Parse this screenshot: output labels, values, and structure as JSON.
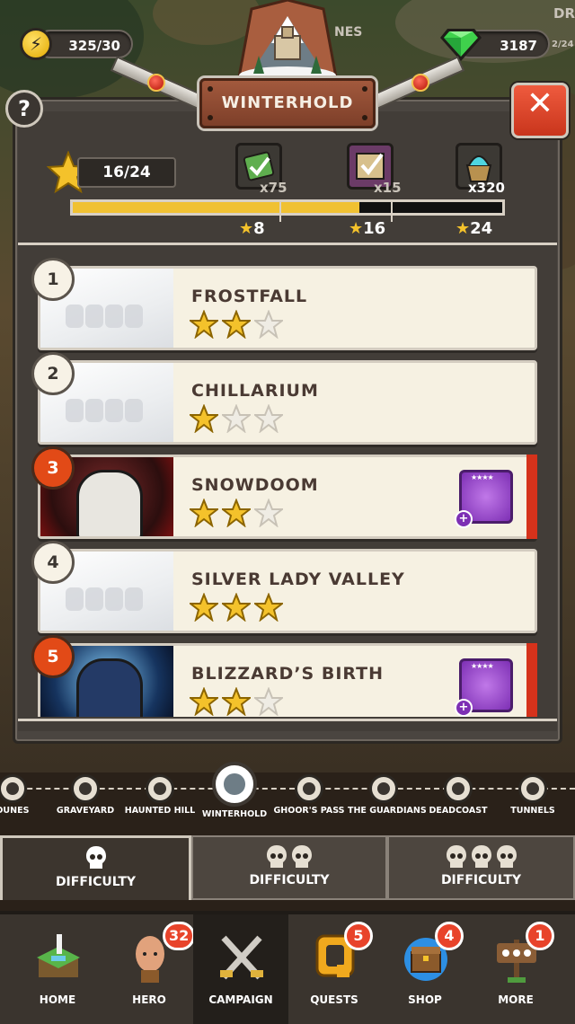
{
  "resources": {
    "energy": "325/30",
    "gems": "3187",
    "map_label_left": "NES",
    "map_label_right": "DR",
    "map_label_right_sub": "2/24"
  },
  "panel": {
    "title": "WINTERHOLD",
    "help_symbol": "?",
    "close_symbol": "✕",
    "stars_collected": "16/24",
    "progress_fraction": 0.667,
    "rewards": [
      {
        "icon": "scroll-icon",
        "qty": "x75",
        "milestone": "8"
      },
      {
        "icon": "map-icon",
        "qty": "x15",
        "milestone": "16"
      },
      {
        "icon": "cauldron-icon",
        "qty": "x320",
        "milestone": "24"
      }
    ]
  },
  "levels": [
    {
      "number": "1",
      "name": "FROSTFALL",
      "stars": 2,
      "type": "done",
      "thumb": "snow",
      "reward": null
    },
    {
      "number": "2",
      "name": "CHILLARIUM",
      "stars": 1,
      "type": "done",
      "thumb": "snow",
      "reward": null
    },
    {
      "number": "3",
      "name": "SNOWDOOM",
      "stars": 2,
      "type": "boss",
      "thumb": "red",
      "reward": "scroll-item",
      "reward_rarity": "★★★★"
    },
    {
      "number": "4",
      "name": "SILVER LADY VALLEY",
      "stars": 3,
      "type": "done",
      "thumb": "snow",
      "reward": null
    },
    {
      "number": "5",
      "name": "BLIZZARD’S BIRTH",
      "stars": 2,
      "type": "boss",
      "thumb": "ice",
      "reward": "boots-item",
      "reward_rarity": "★★★★"
    }
  ],
  "regions": [
    {
      "name": "DUNES"
    },
    {
      "name": "GRAVEYARD"
    },
    {
      "name": "HAUNTED HILL"
    },
    {
      "name": "WINTERHOLD",
      "active": true
    },
    {
      "name": "GHOOR'S PASS"
    },
    {
      "name": "THE GUARDIANS"
    },
    {
      "name": "DEADCOAST"
    },
    {
      "name": "TUNNELS"
    }
  ],
  "difficulty": [
    {
      "label": "DIFFICULTY",
      "skulls": 1,
      "active": true
    },
    {
      "label": "DIFFICULTY",
      "skulls": 2,
      "active": false
    },
    {
      "label": "DIFFICULTY",
      "skulls": 3,
      "active": false
    }
  ],
  "nav": [
    {
      "label": "HOME",
      "icon": "island-icon",
      "badge": ""
    },
    {
      "label": "HERO",
      "icon": "hero-face-icon",
      "badge": "32"
    },
    {
      "label": "CAMPAIGN",
      "icon": "crossed-swords-icon",
      "badge": "",
      "active": true
    },
    {
      "label": "QUESTS",
      "icon": "quest-q-icon",
      "badge": "5"
    },
    {
      "label": "SHOP",
      "icon": "treasure-chest-icon",
      "badge": "4"
    },
    {
      "label": "MORE",
      "icon": "signpost-icon",
      "badge": "1"
    }
  ],
  "colors": {
    "accent_gold": "#f0c132",
    "boss_red": "#e24a17",
    "close_red": "#ef5b3e",
    "panel_bg": "#423d38"
  }
}
